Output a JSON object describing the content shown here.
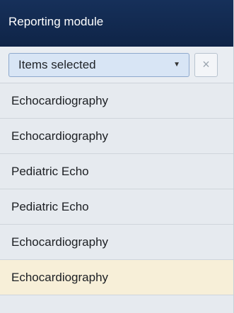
{
  "header": {
    "title": "Reporting module"
  },
  "filter": {
    "selected_label": "Items selected",
    "dropdown_arrow": "▼",
    "clear_symbol": "×"
  },
  "list": {
    "items": [
      {
        "label": "Echocardiography"
      },
      {
        "label": "Echocardiography"
      },
      {
        "label": "Pediatric Echo"
      },
      {
        "label": "Pediatric Echo"
      },
      {
        "label": "Echocardiography"
      },
      {
        "label": "Echocardiography",
        "selected": true
      }
    ]
  },
  "colors": {
    "header_bg": "#132a51",
    "select_bg": "#d8e5f5",
    "selected_row_bg": "#f7efd8"
  }
}
